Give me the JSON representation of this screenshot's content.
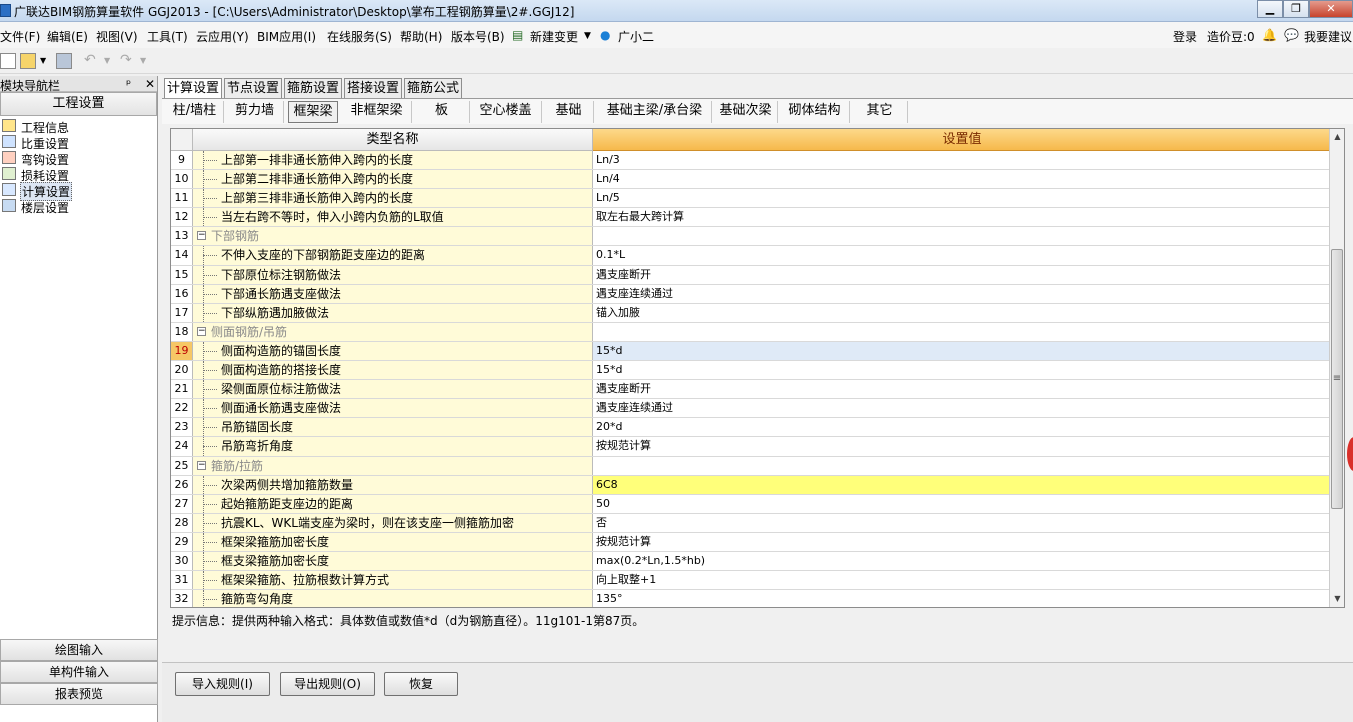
{
  "window": {
    "title": "广联达BIM钢筋算量软件 GGJ2013 - [C:\\Users\\Administrator\\Desktop\\掌布工程钢筋算量\\2#.GGJ12]"
  },
  "menu": {
    "items": [
      "文件(F)",
      "编辑(E)",
      "视图(V)",
      "工具(T)",
      "云应用(Y)",
      "BIM应用(I)",
      "在线服务(S)",
      "帮助(H)",
      "版本号(B)",
      "新建变更",
      "广小二"
    ],
    "right": [
      "登录",
      "造价豆:0",
      "我要建议"
    ]
  },
  "nav": {
    "title": "模块导航栏",
    "pin": "ᵖ",
    "close": "✕",
    "section": "工程设置",
    "items": [
      "工程信息",
      "比重设置",
      "弯钩设置",
      "损耗设置",
      "计算设置",
      "楼层设置"
    ],
    "bottom": [
      "绘图输入",
      "单构件输入",
      "报表预览"
    ]
  },
  "tabs": [
    "计算设置",
    "节点设置",
    "箍筋设置",
    "搭接设置",
    "箍筋公式"
  ],
  "subtabs": [
    "柱/墙柱",
    "剪力墙",
    "框架梁",
    "非框架梁",
    "板",
    "空心楼盖",
    "基础",
    "基础主梁/承台梁",
    "基础次梁",
    "砌体结构",
    "其它"
  ],
  "grid": {
    "header_name": "类型名称",
    "header_value": "设置值",
    "rows": [
      {
        "n": "9",
        "name": "上部第一排非通长筋伸入跨内的长度",
        "value": "Ln/3"
      },
      {
        "n": "10",
        "name": "上部第二排非通长筋伸入跨内的长度",
        "value": "Ln/4"
      },
      {
        "n": "11",
        "name": "上部第三排非通长筋伸入跨内的长度",
        "value": "Ln/5"
      },
      {
        "n": "12",
        "name": "当左右跨不等时，伸入小跨内负筋的L取值",
        "value": "取左右最大跨计算"
      },
      {
        "n": "13",
        "name": "下部钢筋",
        "value": "",
        "group": true
      },
      {
        "n": "14",
        "name": "不伸入支座的下部钢筋距支座边的距离",
        "value": "0.1*L"
      },
      {
        "n": "15",
        "name": "下部原位标注钢筋做法",
        "value": "遇支座断开"
      },
      {
        "n": "16",
        "name": "下部通长筋遇支座做法",
        "value": "遇支座连续通过"
      },
      {
        "n": "17",
        "name": "下部纵筋遇加腋做法",
        "value": "锚入加腋"
      },
      {
        "n": "18",
        "name": "侧面钢筋/吊筋",
        "value": "",
        "group": true
      },
      {
        "n": "19",
        "name": "侧面构造筋的锚固长度",
        "value": "15*d",
        "sel": true
      },
      {
        "n": "20",
        "name": "侧面构造筋的搭接长度",
        "value": "15*d"
      },
      {
        "n": "21",
        "name": "梁侧面原位标注筋做法",
        "value": "遇支座断开"
      },
      {
        "n": "22",
        "name": "侧面通长筋遇支座做法",
        "value": "遇支座连续通过"
      },
      {
        "n": "23",
        "name": "吊筋锚固长度",
        "value": "20*d"
      },
      {
        "n": "24",
        "name": "吊筋弯折角度",
        "value": "按规范计算"
      },
      {
        "n": "25",
        "name": "箍筋/拉筋",
        "value": "",
        "group": true
      },
      {
        "n": "26",
        "name": "次梁两侧共增加箍筋数量",
        "value": "6C8",
        "hl": true
      },
      {
        "n": "27",
        "name": "起始箍筋距支座边的距离",
        "value": "50"
      },
      {
        "n": "28",
        "name": "抗震KL、WKL端支座为梁时，则在该支座一侧箍筋加密",
        "value": "否"
      },
      {
        "n": "29",
        "name": "框架梁箍筋加密长度",
        "value": "按规范计算"
      },
      {
        "n": "30",
        "name": "框支梁箍筋加密长度",
        "value": "max(0.2*Ln,1.5*hb)"
      },
      {
        "n": "31",
        "name": "框架梁箍筋、拉筋根数计算方式",
        "value": "向上取整+1"
      },
      {
        "n": "32",
        "name": "箍筋弯勾角度",
        "value": "135°"
      }
    ]
  },
  "hint": "提示信息：提供两种输入格式：具体数值或数值*d（d为钢筋直径）。11g101-1第87页。",
  "buttons": {
    "import": "导入规则(I)",
    "export": "导出规则(O)",
    "restore": "恢复"
  }
}
